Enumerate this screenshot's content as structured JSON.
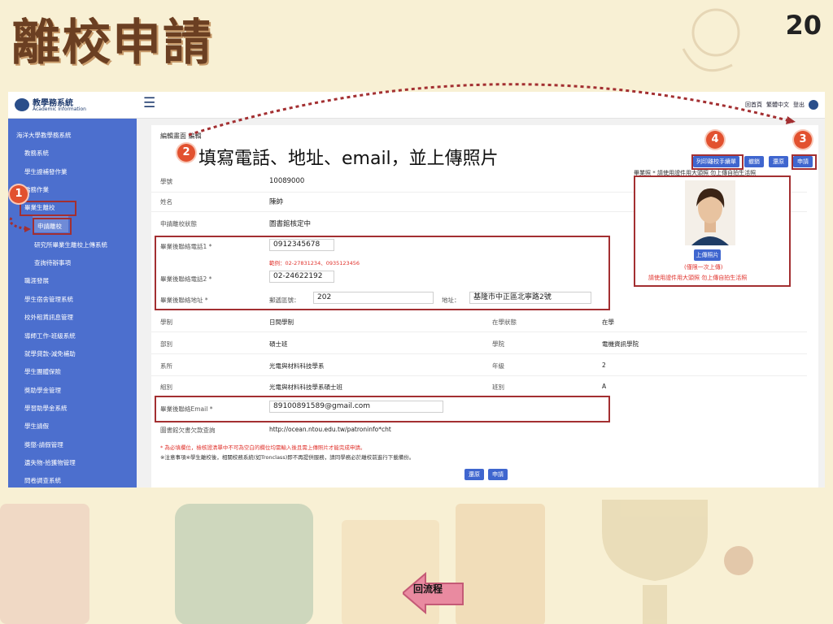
{
  "slide": {
    "title": "離校申請",
    "page_number": "20",
    "step2_text": "填寫電話、地址、email，並上傳照片",
    "back_flow": "回流程",
    "steps": [
      "1",
      "2",
      "3",
      "4"
    ]
  },
  "app": {
    "logo_title": "教學務系統",
    "logo_subtitle": "Academic Information",
    "top_right": [
      "回首頁",
      "繁體中文",
      "登出"
    ]
  },
  "sidebar": {
    "root": "海洋大學教學務系統",
    "items": [
      "教務系統",
      "學生證補發作業",
      "僑務作業",
      "畢業生離校",
      "職涯發展",
      "學生宿舍管理系統",
      "校外租賃訊息管理",
      "導師工作-班級系統",
      "就學貸款-減免補助",
      "學生團體保險",
      "獎助學金管理",
      "學習助學金系統",
      "學生請假",
      "獎懲-請假管理",
      "遺失物-拾獲物管理",
      "問卷調查系統"
    ],
    "subitems": [
      "申請離校",
      "研究所畢業生離校上傳系統",
      "查詢待辦事項"
    ]
  },
  "form": {
    "edit_title": "編輯畫面 編輯",
    "student_id_label": "學號",
    "student_id": "10089000",
    "name_label": "姓名",
    "name": "陳帥",
    "status_label": "申請離校狀態",
    "status": "圖書館核定中",
    "phone1_label": "畢業後聯絡電話1 *",
    "phone1": "0912345678",
    "phone_hint": "範例：02-27831234、0935123456",
    "phone2_label": "畢業後聯絡電話2 *",
    "phone2": "02-24622192",
    "address_label": "畢業後聯絡地址 *",
    "zip_label": "郵遞區號：",
    "zip": "202",
    "addr_label": "地址：",
    "address": "基隆市中正區北寧路2號",
    "system_label": "學制",
    "system": "日間學制",
    "study_status_label": "在學狀態",
    "study_status": "在學",
    "dept_label": "部別",
    "dept": "碩士班",
    "college_label": "學院",
    "college": "電機資訊學院",
    "major_label": "系所",
    "major": "光電與材料科技學系",
    "grade_label": "年級",
    "grade": "2",
    "group_label": "組別",
    "group": "光電與材料科技學系碩士班",
    "class_label": "班別",
    "class": "A",
    "email_label": "畢業後聯絡Email *",
    "email": "89100891589@gmail.com",
    "library_label": "圖書館欠書欠款查詢",
    "library_url": "http://ocean.ntou.edu.tw/patroninfo*cht",
    "note_required": "* 為必填欄位，檢核證清單中不可為空白的欄位均需輸入後且需上傳照片才能完成申請。",
    "note_notice": "※注意事項※學生離校後，相關校務系統(如Tronclass)即不再提供服務，請同學務必於離校前進行下載備份。"
  },
  "buttons": {
    "print": "列印離校手續單",
    "cancel": "撤銷",
    "restore": "還原",
    "apply": "申請",
    "upload": "上傳照片",
    "bottom_restore": "還原",
    "bottom_apply": "申請"
  },
  "photo": {
    "caption_top": "畢業照 *  請使用證件用大頭照 勿上傳自拍生活照",
    "limit": "(僅限一次上傳)",
    "warning": "請使用證件用大頭照 勿上傳自拍生活照"
  }
}
